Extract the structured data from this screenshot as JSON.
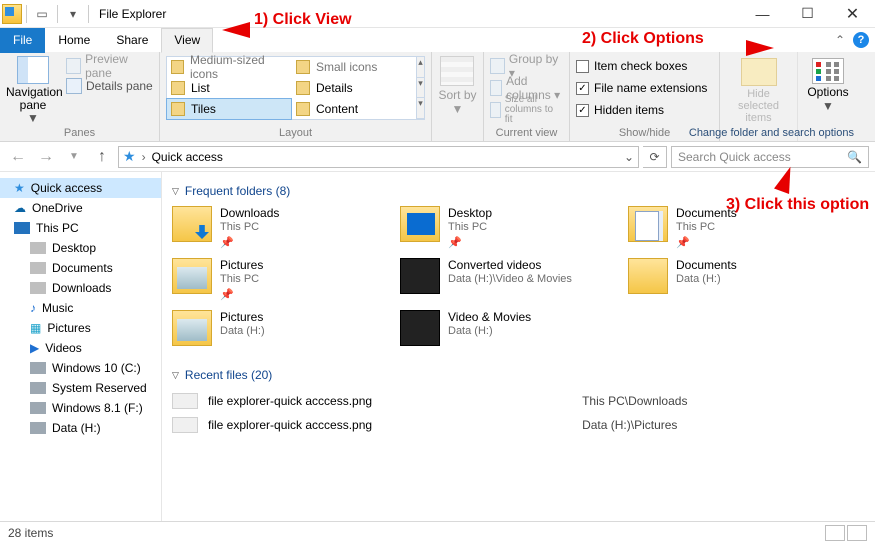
{
  "window": {
    "title": "File Explorer"
  },
  "tabs": {
    "file": "File",
    "home": "Home",
    "share": "Share",
    "view": "View"
  },
  "ribbon": {
    "panes": {
      "nav": "Navigation pane",
      "preview": "Preview pane",
      "details": "Details pane",
      "group": "Panes"
    },
    "layout": {
      "cells": [
        "Medium-sized icons",
        "Small icons",
        "List",
        "Details",
        "Tiles",
        "Content"
      ],
      "group": "Layout"
    },
    "sort": {
      "label": "Sort by",
      "group": "Current view"
    },
    "cur": {
      "group_by": "Group by ▾",
      "add_cols": "Add columns ▾",
      "size_cols": "Size all columns to fit"
    },
    "show": {
      "item_check": "Item check boxes",
      "fne": "File name extensions",
      "hidden": "Hidden items",
      "group": "Show/hide",
      "checks": {
        "item": false,
        "fne": true,
        "hidden": true
      }
    },
    "hide": {
      "label": "Hide selected items"
    },
    "options": {
      "label": "Options",
      "cfso": "Change folder and search options"
    }
  },
  "address": {
    "location": "Quick access"
  },
  "search": {
    "placeholder": "Search Quick access"
  },
  "tree": {
    "items": [
      {
        "label": "Quick access",
        "kind": "star",
        "sel": true
      },
      {
        "label": "OneDrive",
        "kind": "od"
      },
      {
        "label": "This PC",
        "kind": "pc"
      },
      {
        "label": "Desktop",
        "kind": "folder",
        "lvl": 2
      },
      {
        "label": "Documents",
        "kind": "folder",
        "lvl": 2
      },
      {
        "label": "Downloads",
        "kind": "folder",
        "lvl": 2
      },
      {
        "label": "Music",
        "kind": "music",
        "lvl": 2
      },
      {
        "label": "Pictures",
        "kind": "pic",
        "lvl": 2
      },
      {
        "label": "Videos",
        "kind": "vid",
        "lvl": 2
      },
      {
        "label": "Windows 10 (C:)",
        "kind": "drive",
        "lvl": 2
      },
      {
        "label": "System Reserved",
        "kind": "drive",
        "lvl": 2
      },
      {
        "label": "Windows 8.1 (F:)",
        "kind": "drive",
        "lvl": 2
      },
      {
        "label": "Data (H:)",
        "kind": "drive",
        "lvl": 2
      }
    ]
  },
  "sections": {
    "frequent": {
      "title": "Frequent folders (8)"
    },
    "recent": {
      "title": "Recent files (20)"
    }
  },
  "tiles": [
    {
      "name": "Downloads",
      "loc": "This PC",
      "pin": true,
      "cls": "dl"
    },
    {
      "name": "Desktop",
      "loc": "This PC",
      "pin": true,
      "cls": "desk"
    },
    {
      "name": "Documents",
      "loc": "This PC",
      "pin": true,
      "cls": "doc"
    },
    {
      "name": "Pictures",
      "loc": "This PC",
      "pin": true,
      "cls": "pic"
    },
    {
      "name": "Converted videos",
      "loc": "Data (H:)\\Video & Movies",
      "pin": false,
      "cls": "vid"
    },
    {
      "name": "Documents",
      "loc": "Data (H:)",
      "pin": false,
      "cls": ""
    },
    {
      "name": "Pictures",
      "loc": "Data (H:)",
      "pin": false,
      "cls": "pic"
    },
    {
      "name": "Video & Movies",
      "loc": "Data (H:)",
      "pin": false,
      "cls": "vid"
    }
  ],
  "recent": [
    {
      "name": "file explorer-quick acccess.png",
      "path": "This PC\\Downloads"
    },
    {
      "name": "file explorer-quick acccess.png",
      "path": "Data (H:)\\Pictures"
    }
  ],
  "status": {
    "count": "28 items"
  },
  "anno": {
    "a1": "1) Click View",
    "a2": "2) Click Options",
    "a3": "3) Click this option"
  }
}
